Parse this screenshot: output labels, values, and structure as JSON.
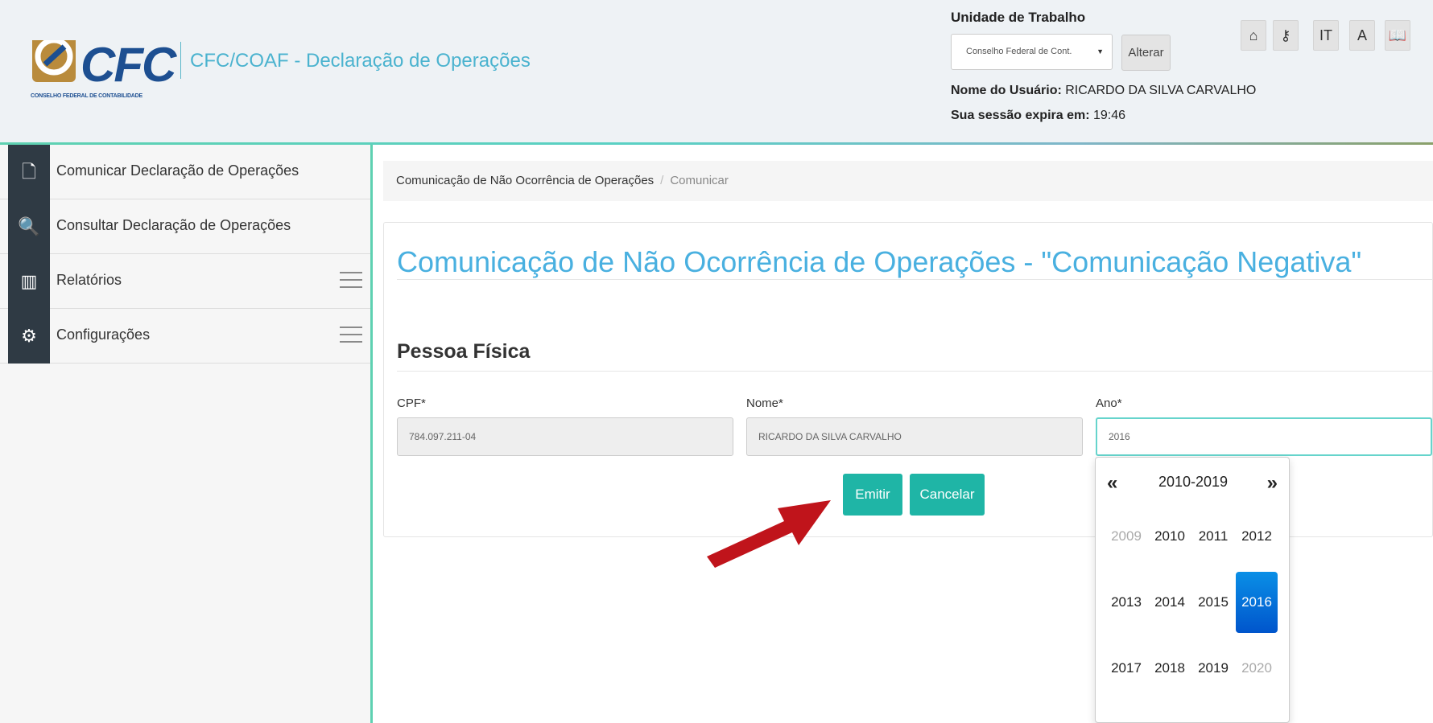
{
  "header": {
    "logo_text": "CFC",
    "logo_subtext": "CONSELHO FEDERAL DE CONTABILIDADE",
    "app_title": "CFC/COAF - Declaração de Operações",
    "unit_label": "Unidade de Trabalho",
    "unit_selected": "Conselho Federal de Cont.",
    "alter_button": "Alterar",
    "user_label": "Nome do Usuário:",
    "user_name": "RICARDO DA SILVA CARVALHO",
    "session_label": "Sua sessão expira em:",
    "session_time": "19:46",
    "tools": [
      {
        "icon": "home-icon",
        "glyph": "⌂"
      },
      {
        "icon": "key-icon",
        "glyph": "⚷"
      },
      {
        "icon": "font-size-icon",
        "glyph": "IT"
      },
      {
        "icon": "font-icon",
        "glyph": "A"
      },
      {
        "icon": "book-icon",
        "glyph": "📖"
      }
    ]
  },
  "sidebar": {
    "items": [
      {
        "label": "Comunicar Declaração de Operações",
        "icon": "file-icon",
        "glyph": "🗋"
      },
      {
        "label": "Consultar Declaração de Operações",
        "icon": "search-icon",
        "glyph": "🔍"
      },
      {
        "label": "Relatórios",
        "icon": "chart-icon",
        "glyph": "▥"
      },
      {
        "label": "Configurações",
        "icon": "gear-icon",
        "glyph": "⚙"
      }
    ]
  },
  "breadcrumb": {
    "parent": "Comunicação de Não Ocorrência de Operações",
    "separator": "/",
    "current": "Comunicar"
  },
  "form": {
    "title": "Comunicação de Não Ocorrência de Operações - \"Comunicação Negativa\"",
    "section": "Pessoa Física",
    "cpf_label": "CPF*",
    "cpf_value": "784.097.211-04",
    "nome_label": "Nome*",
    "nome_value": "RICARDO DA SILVA CARVALHO",
    "ano_label": "Ano*",
    "ano_value": "2016",
    "emit_button": "Emitir",
    "cancel_button": "Cancelar"
  },
  "datepicker": {
    "prev": "«",
    "next": "»",
    "range": "2010-2019",
    "selected": "2016",
    "years": [
      "2009",
      "2010",
      "2011",
      "2012",
      "2013",
      "2014",
      "2015",
      "2016",
      "2017",
      "2018",
      "2019",
      "2020"
    ],
    "out_of_range": [
      "2009",
      "2020"
    ]
  },
  "colors": {
    "accent_teal": "#1fb5a6",
    "title_blue": "#49b0e0",
    "sidebar_icon_bg": "#2f3a44",
    "selected_year": "#0a74da",
    "arrow_red": "#c0141b"
  }
}
